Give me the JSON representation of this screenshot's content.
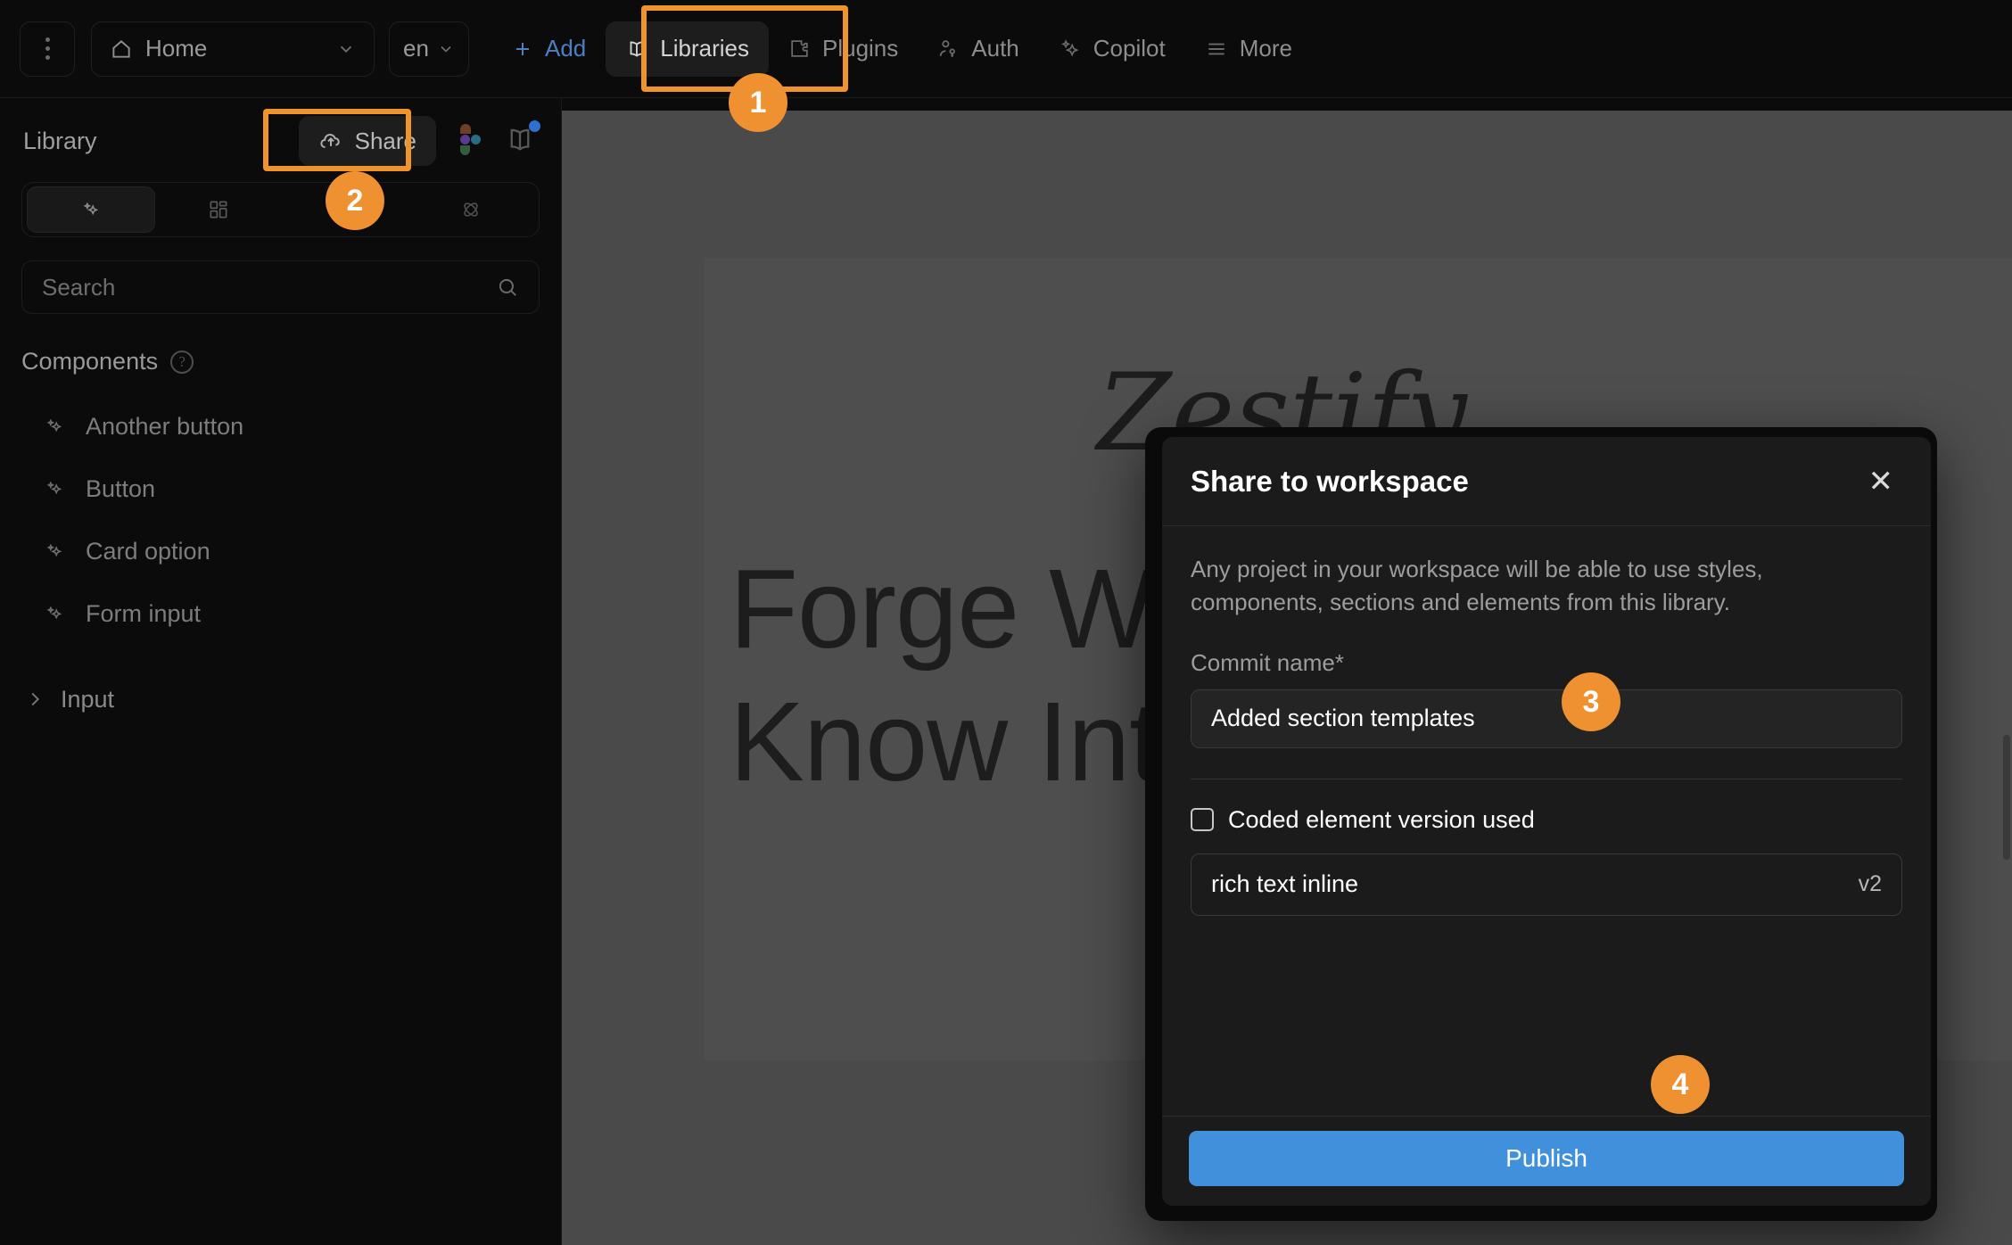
{
  "topbar": {
    "menu_icon": "kebab-menu-icon",
    "page_selector": {
      "icon": "home-icon",
      "label": "Home",
      "chevron": "chevron-down-icon"
    },
    "language": {
      "label": "en",
      "chevron": "chevron-down-icon"
    },
    "nav": [
      {
        "icon": "plus-icon",
        "label": "Add",
        "state": "accent"
      },
      {
        "icon": "book-icon",
        "label": "Libraries",
        "state": "active"
      },
      {
        "icon": "puzzle-icon",
        "label": "Plugins",
        "state": "normal"
      },
      {
        "icon": "user-key-icon",
        "label": "Auth",
        "state": "normal"
      },
      {
        "icon": "sparkle-icon",
        "label": "Copilot",
        "state": "normal"
      },
      {
        "icon": "hamburger-icon",
        "label": "More",
        "state": "normal"
      }
    ]
  },
  "sidebar": {
    "title": "Library",
    "share_label": "Share",
    "share_icon": "cloud-upload-icon",
    "figma_icon": "figma-icon",
    "book_icon": "book-icon",
    "book_badge_color": "#2f6fd0",
    "tabs": [
      {
        "icon": "sparkle-icon",
        "name": "components-tab",
        "active": true
      },
      {
        "icon": "grid-icon",
        "name": "layouts-tab",
        "active": false
      },
      {
        "icon": "plus-icon",
        "name": "add-tab",
        "active": false
      },
      {
        "icon": "atom-icon",
        "name": "styles-tab",
        "active": false
      }
    ],
    "search_placeholder": "Search",
    "search_icon": "search-icon",
    "section_title": "Components",
    "section_help_icon": "help-circle-icon",
    "components": [
      {
        "icon": "sparkle-icon",
        "label": "Another button"
      },
      {
        "icon": "sparkle-icon",
        "label": "Button"
      },
      {
        "icon": "sparkle-icon",
        "label": "Card option"
      },
      {
        "icon": "sparkle-icon",
        "label": "Form input"
      }
    ],
    "tree": [
      {
        "icon": "chevron-right-icon",
        "label": "Input"
      }
    ]
  },
  "canvas": {
    "logo_text": "Zestify",
    "headline_line1": "Forge What You",
    "headline_line2": "Know Into Something"
  },
  "modal": {
    "title": "Share to workspace",
    "close_icon": "close-icon",
    "description": "Any project in your workspace will be able to use styles, components, sections and elements from this library.",
    "commit_label": "Commit name",
    "commit_required": "*",
    "commit_value": "Added section templates",
    "checkbox_label": "Coded element version used",
    "checkbox_checked": false,
    "select_value": "rich text inline",
    "select_version": "v2",
    "publish_label": "Publish",
    "publish_color": "#4190db"
  },
  "annotations": {
    "accent_color": "#ef9031",
    "steps": [
      {
        "number": "1",
        "target": "Libraries top-bar tab"
      },
      {
        "number": "2",
        "target": "Share button in library panel"
      },
      {
        "number": "3",
        "target": "Commit name input"
      },
      {
        "number": "4",
        "target": "Publish button"
      }
    ]
  }
}
